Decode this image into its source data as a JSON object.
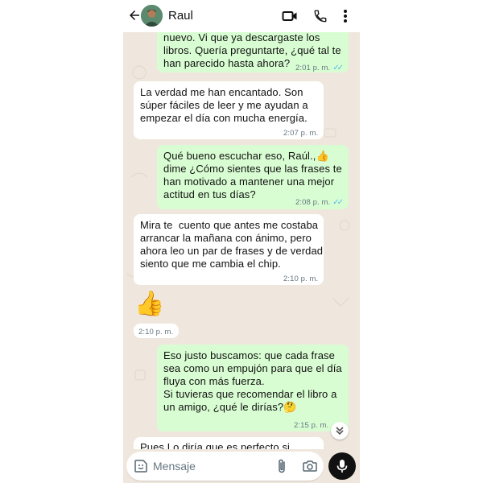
{
  "header": {
    "contact_name": "Raul",
    "icons": [
      "back-arrow-icon",
      "avatar",
      "video-call-icon",
      "phone-call-icon",
      "more-vert-icon"
    ]
  },
  "messages": [
    {
      "direction": "out",
      "lines": [
        "nuevo. Vi que ya descargaste los",
        "libros. Quería preguntarte, ¿qué tal te",
        "han parecido hasta ahora?"
      ],
      "time": "2:01 p. m.",
      "read": true
    },
    {
      "direction": "in",
      "lines": [
        "La verdad me han encantado. Son",
        "súper fáciles de leer y me ayudan a",
        "empezar el día con mucha energía."
      ],
      "time": "2:07 p. m."
    },
    {
      "direction": "out",
      "lines": [
        "Qué bueno escuchar eso, Raúl.,👍",
        "dime ¿Cómo sientes que las frases te",
        "han motivado a mantener una mejor",
        "actitud en tus días?"
      ],
      "time": "2:08 p. m.",
      "read": true
    },
    {
      "direction": "in",
      "lines": [
        "Mira te  cuento que antes me costaba",
        "arrancar la mañana con ánimo, pero",
        "ahora leo un par de frases y de verdad",
        "siento que me cambia el chip."
      ],
      "time": "2:10 p. m."
    },
    {
      "direction": "in",
      "emoji": "👍",
      "time": "2:10 p. m."
    },
    {
      "direction": "out",
      "lines": [
        "Eso justo buscamos: que cada frase",
        "sea como un empujón para que el día",
        "fluya con más fuerza.",
        "Si tuvieras que recomendar el libro a",
        "un amigo, ¿qué le dirías?🤔"
      ],
      "time": "2:15 p. m."
    },
    {
      "direction": "in",
      "lines": [
        "Pues Lo diría que es perfecto si"
      ]
    }
  ],
  "composer": {
    "placeholder": "Mensaje",
    "icons": [
      "sticker-icon",
      "attach-icon",
      "camera-icon",
      "mic-icon"
    ]
  },
  "colors": {
    "outgoing_bubble": "#d9fdd3",
    "incoming_bubble": "#ffffff",
    "chat_background": "#efe7dd",
    "read_ticks": "#53bdeb",
    "mic_button": "#111111"
  }
}
